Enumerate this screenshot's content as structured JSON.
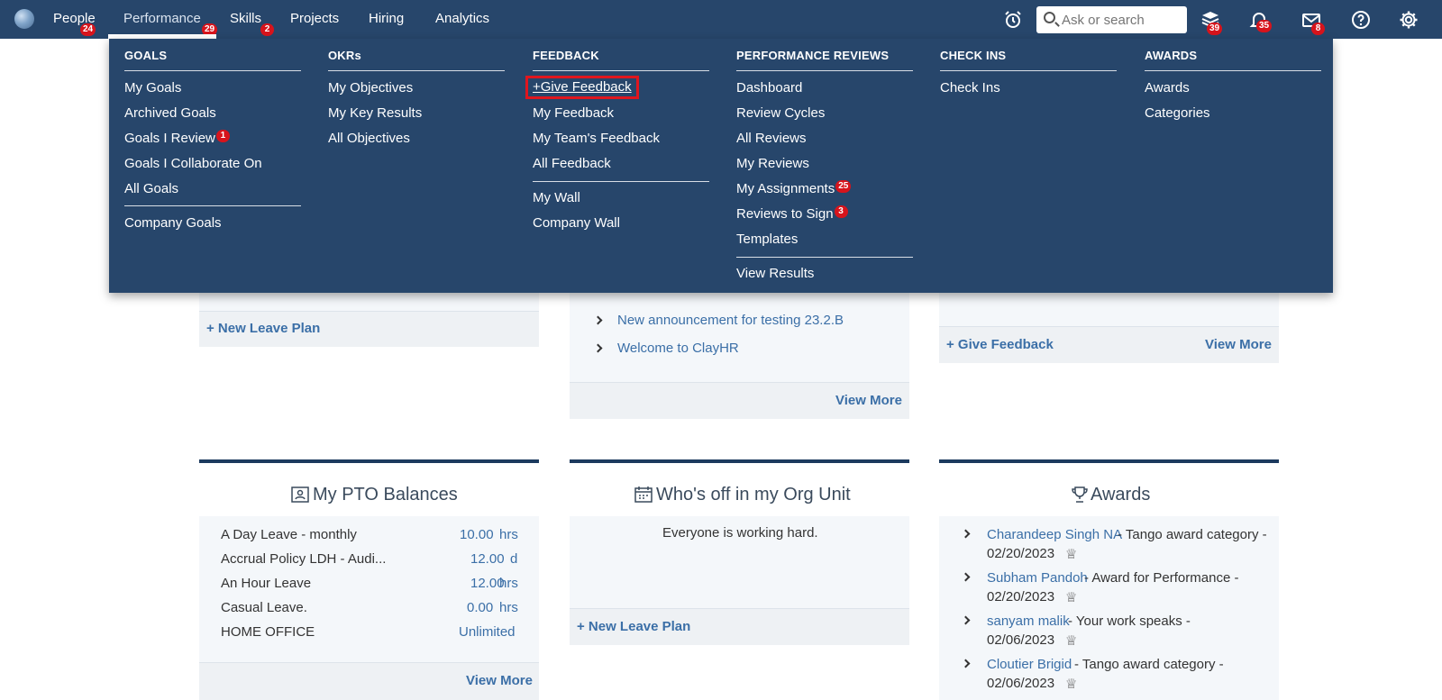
{
  "nav": {
    "items": [
      {
        "label": "People",
        "badge": "24"
      },
      {
        "label": "Performance",
        "badge": "29"
      },
      {
        "label": "Skills",
        "badge": "2"
      },
      {
        "label": "Projects"
      },
      {
        "label": "Hiring"
      },
      {
        "label": "Analytics"
      }
    ],
    "search_placeholder": "Ask or search",
    "badges": {
      "stack": "39",
      "bell": "35",
      "mail": "8"
    }
  },
  "menu": {
    "goals": {
      "header": "GOALS",
      "items": [
        "My Goals",
        "Archived Goals",
        "Goals I Review",
        "Goals I Collaborate On",
        "All Goals",
        "Company Goals"
      ],
      "review_badge": "1"
    },
    "okrs": {
      "header": "OKRs",
      "items": [
        "My Objectives",
        "My Key Results",
        "All Objectives"
      ]
    },
    "feedback": {
      "header": "FEEDBACK",
      "items": [
        "+Give Feedback",
        "My Feedback",
        "My Team's Feedback",
        "All Feedback",
        "My Wall",
        "Company Wall"
      ]
    },
    "reviews": {
      "header": "PERFORMANCE REVIEWS",
      "items": [
        "Dashboard",
        "Review Cycles",
        "All Reviews",
        "My Reviews",
        "My Assignments",
        "Reviews to Sign",
        "Templates",
        "View Results"
      ],
      "assign_badge": "25",
      "sign_badge": "3"
    },
    "checkins": {
      "header": "CHECK INS",
      "items": [
        "Check Ins"
      ]
    },
    "awards": {
      "header": "AWARDS",
      "items": [
        "Awards",
        "Categories"
      ]
    }
  },
  "bg": {
    "new_leave_plan": "+ New Leave Plan",
    "announcements": [
      "New announcement for testing 23.2.B",
      "Welcome to ClayHR"
    ],
    "view_more": "View More",
    "give_feedback": "+ Give Feedback",
    "pto": {
      "title": "My PTO Balances",
      "rows": [
        {
          "name": "A Day Leave - monthly",
          "value": "10.00",
          "unit": "hrs"
        },
        {
          "name": "Accrual Policy LDH - Audi...",
          "value": "12.00",
          "unit": "d"
        },
        {
          "name": "An Hour Leave",
          "value": "12.00",
          "unit": "hrs"
        },
        {
          "name": "Casual Leave.",
          "value": "0.00",
          "unit": "hrs"
        },
        {
          "name": "HOME OFFICE",
          "value": "Unlimited",
          "unit": ""
        }
      ]
    },
    "whosoff": {
      "title": "Who's off in my Org Unit",
      "message": "Everyone is working hard."
    },
    "awards": {
      "title": "Awards",
      "items": [
        {
          "name": "Charandeep Singh NA",
          "text": "- Tango award category -",
          "date": "02/20/2023"
        },
        {
          "name": "Subham Pandoh",
          "text": "- Award for Performance -",
          "date": "02/20/2023"
        },
        {
          "name": "sanyam malik",
          "text": "- Your work speaks -",
          "date": "02/06/2023"
        },
        {
          "name": "Cloutier Brigid",
          "text": "- Tango award category -",
          "date": "02/06/2023"
        }
      ]
    }
  }
}
